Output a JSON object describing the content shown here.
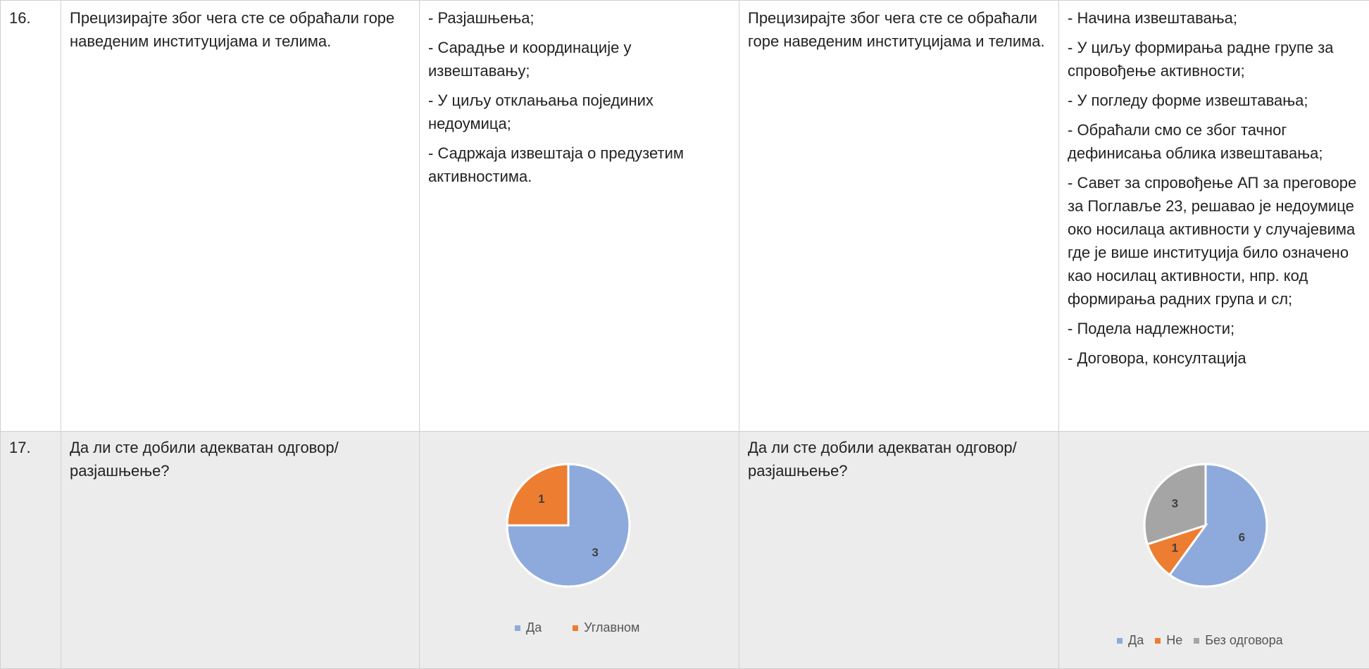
{
  "colors": {
    "blue": "#8eaadc",
    "orange": "#ed7d31",
    "gray": "#a5a5a5",
    "border": "#d0d0d0",
    "row_shade": "#ececec"
  },
  "rows": [
    {
      "number": "16.",
      "question_left": "Прецизирајте због чега сте се обраћали горе наведеним институцијама и телима.",
      "answers_left": [
        "- Разјашњења;",
        "- Сарадње и координације у извештавању;",
        "- У циљу отклањања појединих недоумица;",
        "- Садржаја извештаја о предузетим активностима."
      ],
      "question_right": "Прецизирајте због чега сте се обраћали горе наведеним институцијама и телима.",
      "answers_right": [
        "- Начина извештавања;",
        "- У циљу формирања радне групе за спровођење активности;",
        "- У погледу форме извештавања;",
        "- Обраћали смо се због тачног дефинисања облика извештавања;",
        "- Савет за спровођење АП за преговоре за Поглавље 23, решавао је недоумице око носилаца активности у случајевима где је више институција било означено као носилац активности, нпр. код формирања радних група и сл;",
        "- Подела надлежности;",
        "- Договора, консултација"
      ]
    },
    {
      "number": "17.",
      "question_left": "Да ли сте добили адекватан одговор/разјашњење?",
      "question_right": "Да ли сте добили адекватан одговор/разјашњење?"
    }
  ],
  "chart_data": [
    {
      "type": "pie",
      "categories": [
        "Да",
        "Углавном"
      ],
      "values": [
        3,
        1
      ],
      "colors": [
        "#8eaadc",
        "#ed7d31"
      ],
      "legend": [
        "Да",
        "Углавном"
      ],
      "legend_position": "bottom",
      "data_labels": [
        "3",
        "1"
      ]
    },
    {
      "type": "pie",
      "categories": [
        "Да",
        "Не",
        "Без одговора"
      ],
      "values": [
        6,
        1,
        3
      ],
      "colors": [
        "#8eaadc",
        "#ed7d31",
        "#a5a5a5"
      ],
      "legend": [
        "Да",
        "Не",
        "Без одговора"
      ],
      "legend_position": "bottom",
      "data_labels": [
        "6",
        "1",
        "3"
      ]
    }
  ]
}
